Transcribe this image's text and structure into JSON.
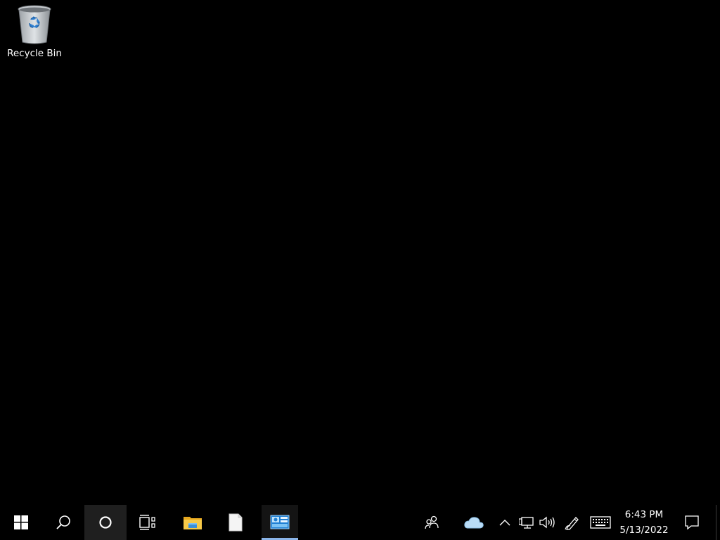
{
  "desktop": {
    "background_color": "#000000",
    "icons": [
      {
        "label": "Recycle Bin",
        "icon": "recycle-bin-icon"
      }
    ]
  },
  "taskbar": {
    "start": {
      "icon": "windows-logo-icon"
    },
    "search": {
      "icon": "search-icon"
    },
    "cortana": {
      "icon": "cortana-icon",
      "state": "hovered"
    },
    "task_view": {
      "icon": "task-view-icon"
    },
    "pinned_apps": [
      {
        "name": "file-explorer",
        "icon": "folder-icon"
      },
      {
        "name": "notepad",
        "icon": "blank-document-icon"
      },
      {
        "name": "control-panel",
        "icon": "control-panel-icon",
        "running": true
      }
    ],
    "tray": {
      "people": {
        "icon": "people-icon"
      },
      "onedrive": {
        "icon": "cloud-icon"
      },
      "show_hidden": {
        "icon": "chevron-up-icon"
      },
      "network": {
        "icon": "network-icon"
      },
      "volume": {
        "icon": "volume-icon"
      },
      "pen": {
        "icon": "pen-icon"
      },
      "keyboard": {
        "icon": "touch-keyboard-icon"
      }
    },
    "clock": {
      "time": "6:43 PM",
      "date": "5/13/2022"
    },
    "notifications": {
      "icon": "action-center-icon"
    },
    "accent_color": "#8ab4e8"
  }
}
